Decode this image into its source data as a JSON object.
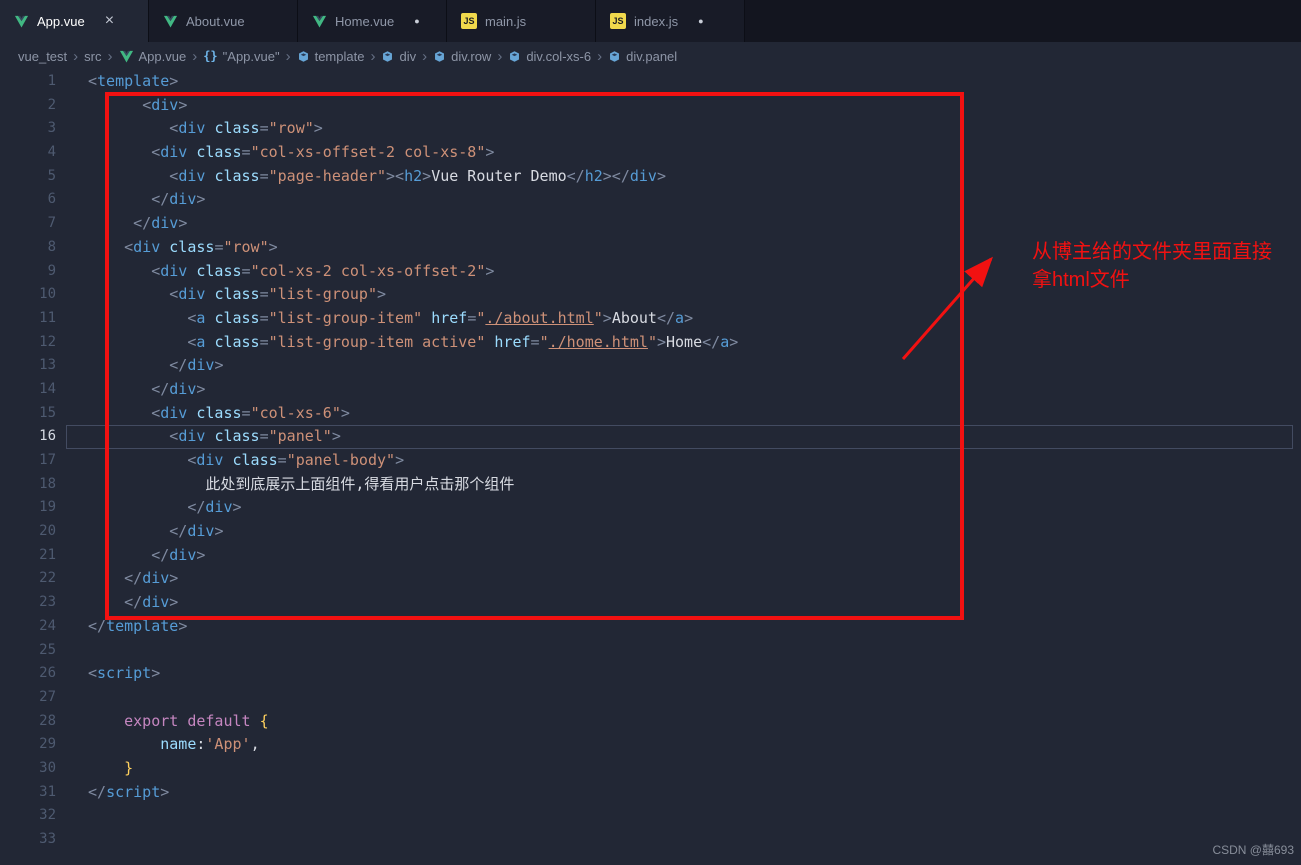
{
  "tabs": [
    {
      "label": "App.vue",
      "icon": "vue",
      "active": true,
      "has_close": true,
      "modified": false
    },
    {
      "label": "About.vue",
      "icon": "vue",
      "active": false,
      "has_close": false,
      "modified": false
    },
    {
      "label": "Home.vue",
      "icon": "vue",
      "active": false,
      "has_close": false,
      "modified": true
    },
    {
      "label": "main.js",
      "icon": "js",
      "active": false,
      "has_close": false,
      "modified": false
    },
    {
      "label": "index.js",
      "icon": "js",
      "active": false,
      "has_close": false,
      "modified": true
    }
  ],
  "close_glyph": "×",
  "modified_glyph": "●",
  "breadcrumb": {
    "separator": "›",
    "items": [
      {
        "label": "vue_test",
        "icon": null
      },
      {
        "label": "src",
        "icon": null
      },
      {
        "label": "App.vue",
        "icon": "vue"
      },
      {
        "label": "\"App.vue\"",
        "icon": "braces"
      },
      {
        "label": "template",
        "icon": "field"
      },
      {
        "label": "div",
        "icon": "field"
      },
      {
        "label": "div.row",
        "icon": "field"
      },
      {
        "label": "div.col-xs-6",
        "icon": "field"
      },
      {
        "label": "div.panel",
        "icon": "field"
      }
    ]
  },
  "editor": {
    "active_line": 16,
    "lines": [
      [
        [
          "p",
          "<"
        ],
        [
          "t",
          "template"
        ],
        [
          "p",
          ">"
        ]
      ],
      [
        [
          "w",
          "      "
        ],
        [
          "p",
          "<"
        ],
        [
          "t",
          "div"
        ],
        [
          "p",
          ">"
        ]
      ],
      [
        [
          "w",
          "         "
        ],
        [
          "p",
          "<"
        ],
        [
          "t",
          "div"
        ],
        [
          "w",
          " "
        ],
        [
          "a",
          "class"
        ],
        [
          "p",
          "="
        ],
        [
          "s",
          "\"row\""
        ],
        [
          "p",
          ">"
        ]
      ],
      [
        [
          "w",
          "       "
        ],
        [
          "p",
          "<"
        ],
        [
          "t",
          "div"
        ],
        [
          "w",
          " "
        ],
        [
          "a",
          "class"
        ],
        [
          "p",
          "="
        ],
        [
          "s",
          "\"col-xs-offset-2 col-xs-8\""
        ],
        [
          "p",
          ">"
        ]
      ],
      [
        [
          "w",
          "         "
        ],
        [
          "p",
          "<"
        ],
        [
          "t",
          "div"
        ],
        [
          "w",
          " "
        ],
        [
          "a",
          "class"
        ],
        [
          "p",
          "="
        ],
        [
          "s",
          "\"page-header\""
        ],
        [
          "p",
          "><"
        ],
        [
          "t",
          "h2"
        ],
        [
          "p",
          ">"
        ],
        [
          "w",
          "Vue Router Demo"
        ],
        [
          "p",
          "</"
        ],
        [
          "t",
          "h2"
        ],
        [
          "p",
          "></"
        ],
        [
          "t",
          "div"
        ],
        [
          "p",
          ">"
        ]
      ],
      [
        [
          "w",
          "       "
        ],
        [
          "p",
          "</"
        ],
        [
          "t",
          "div"
        ],
        [
          "p",
          ">"
        ]
      ],
      [
        [
          "w",
          "     "
        ],
        [
          "p",
          "</"
        ],
        [
          "t",
          "div"
        ],
        [
          "p",
          ">"
        ]
      ],
      [
        [
          "w",
          "    "
        ],
        [
          "p",
          "<"
        ],
        [
          "t",
          "div"
        ],
        [
          "w",
          " "
        ],
        [
          "a",
          "class"
        ],
        [
          "p",
          "="
        ],
        [
          "s",
          "\"row\""
        ],
        [
          "p",
          ">"
        ]
      ],
      [
        [
          "w",
          "       "
        ],
        [
          "p",
          "<"
        ],
        [
          "t",
          "div"
        ],
        [
          "w",
          " "
        ],
        [
          "a",
          "class"
        ],
        [
          "p",
          "="
        ],
        [
          "s",
          "\"col-xs-2 col-xs-offset-2\""
        ],
        [
          "p",
          ">"
        ]
      ],
      [
        [
          "w",
          "         "
        ],
        [
          "p",
          "<"
        ],
        [
          "t",
          "div"
        ],
        [
          "w",
          " "
        ],
        [
          "a",
          "class"
        ],
        [
          "p",
          "="
        ],
        [
          "s",
          "\"list-group\""
        ],
        [
          "p",
          ">"
        ]
      ],
      [
        [
          "w",
          "           "
        ],
        [
          "p",
          "<"
        ],
        [
          "t",
          "a"
        ],
        [
          "w",
          " "
        ],
        [
          "a",
          "class"
        ],
        [
          "p",
          "="
        ],
        [
          "s",
          "\"list-group-item\""
        ],
        [
          "w",
          " "
        ],
        [
          "a",
          "href"
        ],
        [
          "p",
          "="
        ],
        [
          "s",
          "\""
        ],
        [
          "u",
          "./about.html"
        ],
        [
          "s",
          "\""
        ],
        [
          "p",
          ">"
        ],
        [
          "w",
          "About"
        ],
        [
          "p",
          "</"
        ],
        [
          "t",
          "a"
        ],
        [
          "p",
          ">"
        ]
      ],
      [
        [
          "w",
          "           "
        ],
        [
          "p",
          "<"
        ],
        [
          "t",
          "a"
        ],
        [
          "w",
          " "
        ],
        [
          "a",
          "class"
        ],
        [
          "p",
          "="
        ],
        [
          "s",
          "\"list-group-item active\""
        ],
        [
          "w",
          " "
        ],
        [
          "a",
          "href"
        ],
        [
          "p",
          "="
        ],
        [
          "s",
          "\""
        ],
        [
          "u",
          "./home.html"
        ],
        [
          "s",
          "\""
        ],
        [
          "p",
          ">"
        ],
        [
          "w",
          "Home"
        ],
        [
          "p",
          "</"
        ],
        [
          "t",
          "a"
        ],
        [
          "p",
          ">"
        ]
      ],
      [
        [
          "w",
          "         "
        ],
        [
          "p",
          "</"
        ],
        [
          "t",
          "div"
        ],
        [
          "p",
          ">"
        ]
      ],
      [
        [
          "w",
          "       "
        ],
        [
          "p",
          "</"
        ],
        [
          "t",
          "div"
        ],
        [
          "p",
          ">"
        ]
      ],
      [
        [
          "w",
          "       "
        ],
        [
          "p",
          "<"
        ],
        [
          "t",
          "div"
        ],
        [
          "w",
          " "
        ],
        [
          "a",
          "class"
        ],
        [
          "p",
          "="
        ],
        [
          "s",
          "\"col-xs-6\""
        ],
        [
          "p",
          ">"
        ]
      ],
      [
        [
          "w",
          "         "
        ],
        [
          "p",
          "<"
        ],
        [
          "t",
          "div"
        ],
        [
          "w",
          " "
        ],
        [
          "a",
          "class"
        ],
        [
          "p",
          "="
        ],
        [
          "s",
          "\"panel\""
        ],
        [
          "p",
          ">"
        ]
      ],
      [
        [
          "w",
          "           "
        ],
        [
          "p",
          "<"
        ],
        [
          "t",
          "div"
        ],
        [
          "w",
          " "
        ],
        [
          "a",
          "class"
        ],
        [
          "p",
          "="
        ],
        [
          "s",
          "\"panel-body\""
        ],
        [
          "p",
          ">"
        ]
      ],
      [
        [
          "w",
          "             此处到底展示上面组件,得看用户点击那个组件"
        ]
      ],
      [
        [
          "w",
          "           "
        ],
        [
          "p",
          "</"
        ],
        [
          "t",
          "div"
        ],
        [
          "p",
          ">"
        ]
      ],
      [
        [
          "w",
          "         "
        ],
        [
          "p",
          "</"
        ],
        [
          "t",
          "div"
        ],
        [
          "p",
          ">"
        ]
      ],
      [
        [
          "w",
          "       "
        ],
        [
          "p",
          "</"
        ],
        [
          "t",
          "div"
        ],
        [
          "p",
          ">"
        ]
      ],
      [
        [
          "w",
          "    "
        ],
        [
          "p",
          "</"
        ],
        [
          "t",
          "div"
        ],
        [
          "p",
          ">"
        ]
      ],
      [
        [
          "w",
          "    "
        ],
        [
          "p",
          "</"
        ],
        [
          "t",
          "div"
        ],
        [
          "p",
          ">"
        ]
      ],
      [
        [
          "p",
          "</"
        ],
        [
          "t",
          "template"
        ],
        [
          "p",
          ">"
        ]
      ],
      [],
      [
        [
          "p",
          "<"
        ],
        [
          "t",
          "script"
        ],
        [
          "p",
          ">"
        ]
      ],
      [],
      [
        [
          "w",
          "    "
        ],
        [
          "k",
          "export"
        ],
        [
          "w",
          " "
        ],
        [
          "k",
          "default"
        ],
        [
          "w",
          " "
        ],
        [
          "b",
          "{"
        ]
      ],
      [
        [
          "w",
          "        "
        ],
        [
          "a",
          "name"
        ],
        [
          "w",
          ":"
        ],
        [
          "s",
          "'App'"
        ],
        [
          "w",
          ","
        ]
      ],
      [
        [
          "w",
          "    "
        ],
        [
          "b",
          "}"
        ]
      ],
      [
        [
          "p",
          "</"
        ],
        [
          "t",
          "script"
        ],
        [
          "p",
          ">"
        ]
      ],
      [],
      []
    ]
  },
  "annotation": {
    "line1": "从博主给的文件夹里面直接",
    "line2": "拿html文件",
    "color": "#f21111"
  },
  "watermark": "CSDN @囍693",
  "colors": {
    "editor_bg": "#222735",
    "tabbar_bg": "#13151f",
    "tag": "#569cd6",
    "attribute": "#9cdcfe",
    "string": "#ce9178",
    "keyword": "#c586c0",
    "brace": "#ffd15e",
    "vue_green": "#41b883",
    "js_yellow": "#f0d94c",
    "annotation_red": "#f21111"
  }
}
